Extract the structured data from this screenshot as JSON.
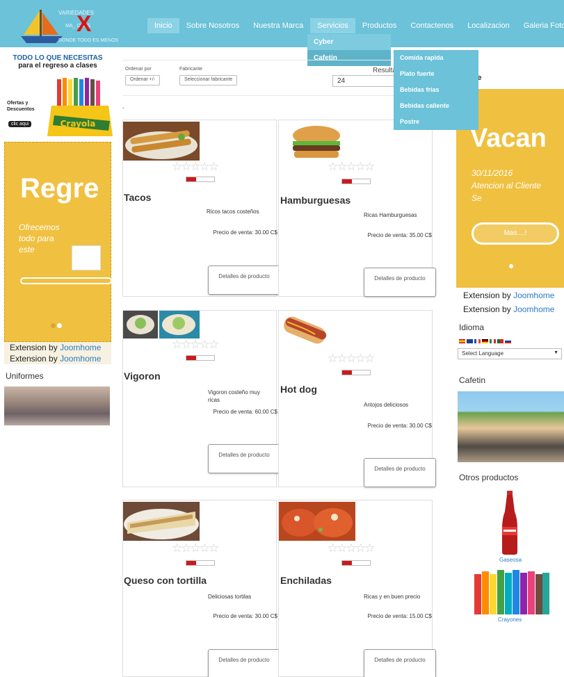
{
  "logo": {
    "line1": "VARIEDADES",
    "line2": "MA_  ONES",
    "line3": "DONDE TODO ES MENOS"
  },
  "nav": {
    "items": [
      "Inicio",
      "Sobre Nosotros",
      "Nuestra Marca",
      "Servicios",
      "Productos",
      "Contactenos",
      "Localizacion",
      "Galeria Fotos"
    ],
    "active": "Inicio",
    "open": "Servicios"
  },
  "servicios_menu": [
    "Cyber",
    "Cafetin"
  ],
  "cafetin_menu": [
    "Comida rapida",
    "Plato fuerte",
    "Bebidas frias",
    "Bebidas caliente",
    "Postre"
  ],
  "left_ad": {
    "title1": "TODO LO QUE NECESITAS",
    "title2": "para el regreso a clases",
    "ofertas": "Ofertas y Descuentos",
    "clic": "clic aqui",
    "brand": "Crayola"
  },
  "left_slide": {
    "big": "Regre",
    "text": "Ofrecemos todo para este"
  },
  "extension": {
    "prefix": "Extension by",
    "link": "Joomhome"
  },
  "uniformes_title": "Uniformes",
  "toolbar": {
    "ordenar_label": "Ordenar por",
    "ordenar_btn": "Ordenar +/-",
    "fabricante_label": "Fabricante",
    "fabricante_btn": "Seleccionar fabricante",
    "resultados_label": "Resulta",
    "resultados_value": "24"
  },
  "dash": "-",
  "products": [
    {
      "name": "Tacos",
      "desc": "Ricos tacos costeños",
      "price_label": "Precio de venta:",
      "price": "30.00 C$",
      "button": "Detalles de producto",
      "stars": 5,
      "rating": 0
    },
    {
      "name": "Hamburguesas",
      "desc": "Ricas Hamburguesas",
      "price_label": "Precio de venta:",
      "price": "35.00 C$",
      "button": "Detalles de producto",
      "stars": 5,
      "rating": 0
    },
    {
      "name": "Vigoron",
      "desc": "Vigoron costeño muy ricas",
      "price_label": "Precio de venta:",
      "price": "60.00 C$",
      "button": "Detalles de producto",
      "stars": 5,
      "rating": 0
    },
    {
      "name": "Hot dog",
      "desc": "Antojos deliciosos",
      "price_label": "Precio de venta:",
      "price": "30.00 C$",
      "button": "Detalles de producto",
      "stars": 5,
      "rating": 0
    },
    {
      "name": "Queso con tortilla",
      "desc": "Deliciosas tortilas",
      "price_label": "Precio de venta:",
      "price": "30.00 C$",
      "button": "Detalles de producto",
      "stars": 5,
      "rating": 0
    },
    {
      "name": "Enchiladas",
      "desc": "Ricas y en buen precio",
      "price_label": "Precio de venta:",
      "price": "15.00 C$",
      "button": "Detalles de producto",
      "stars": 5,
      "rating": 0
    }
  ],
  "right": {
    "title": "nte",
    "slide_big": "Vacan",
    "slide_date": "30/11/2016",
    "slide_text": "Atencion al Cliente Se",
    "slide_btn": "Mas....!",
    "idioma_title": "Idioma",
    "language_select": "Select Language",
    "cafetin_title": "Cafetin",
    "otros_title": "Otros productos",
    "prod1": "Gaseosa",
    "prod2": "Crayones"
  }
}
